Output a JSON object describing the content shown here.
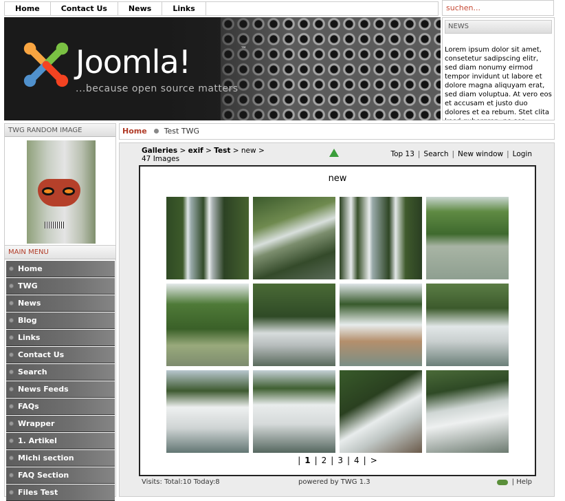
{
  "nav": {
    "items": [
      "Home",
      "Contact Us",
      "News",
      "Links"
    ]
  },
  "search": {
    "placeholder": "suchen..."
  },
  "banner": {
    "logo_text": "Joomla!",
    "tm": "™",
    "tagline": "...because open source matters"
  },
  "news_module": {
    "title": "NEWS",
    "body": "Lorem ipsum dolor sit amet, consetetur sadipscing elitr, sed diam nonumy eirmod tempor invidunt ut labore et dolore magna aliquyam erat, sed diam voluptua. At vero eos et accusam et justo duo dolores et ea rebum. Stet clita kasd gubergren, no sea takimata"
  },
  "random_image": {
    "title": "TWG RANDOM IMAGE"
  },
  "main_menu": {
    "title": "MAIN MENU",
    "items": [
      "Home",
      "TWG",
      "News",
      "Blog",
      "Links",
      "Contact Us",
      "Search",
      "News Feeds",
      "FAQs",
      "Wrapper",
      "1. Artikel",
      "Michi section",
      "FAQ Section",
      "Files Test"
    ]
  },
  "pathway": {
    "home": "Home",
    "current": "Test TWG"
  },
  "twg": {
    "crumbs": [
      "Galleries",
      "exif",
      "Test",
      "new"
    ],
    "crumb_sep": ">",
    "image_count": "47 Images",
    "links": [
      "Top 13",
      "Search",
      "New window",
      "Login"
    ],
    "gallery_title": "new",
    "pager": [
      "|",
      "1",
      "|",
      "2",
      "|",
      "3",
      "|",
      "4",
      "|",
      ">"
    ],
    "footer_visits": "Visits: Total:10 Today:8",
    "footer_powered": "powered by TWG 1.3",
    "footer_help": "| Help"
  },
  "colors": {
    "accent_red": "#b03a26",
    "menu_gray": "#6a6a6a",
    "up_arrow_green": "#3a9d3a"
  }
}
